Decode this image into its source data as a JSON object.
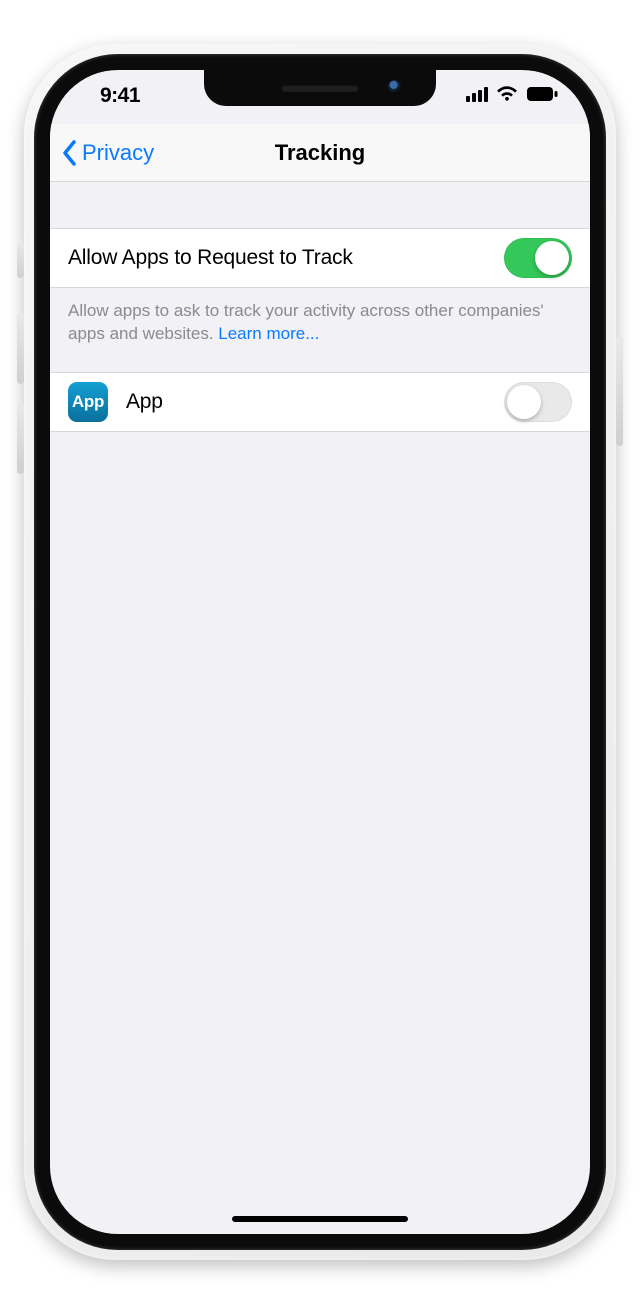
{
  "status_bar": {
    "time": "9:41"
  },
  "nav": {
    "back_label": "Privacy",
    "title": "Tracking"
  },
  "main_toggle": {
    "label": "Allow Apps to Request to Track",
    "on": true
  },
  "footer": {
    "text": "Allow apps to ask to track your activity across other companies' apps and websites. ",
    "link_label": "Learn more..."
  },
  "apps": [
    {
      "icon_text": "App",
      "name": "App",
      "on": false
    }
  ],
  "colors": {
    "accent_blue": "#0a7aff",
    "switch_on": "#34c759"
  }
}
